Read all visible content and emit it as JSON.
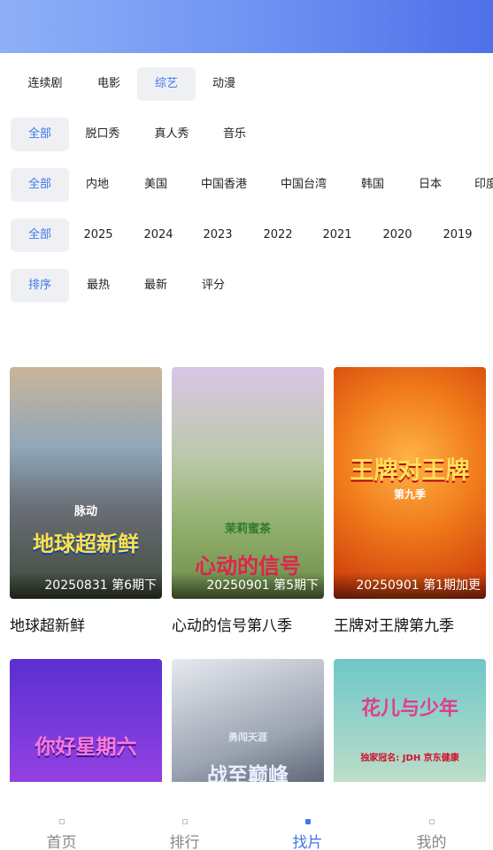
{
  "category_tabs": [
    "连续剧",
    "电影",
    "综艺",
    "动漫"
  ],
  "filters": {
    "type_row": {
      "first": "全部",
      "items": [
        "脱口秀",
        "真人秀",
        "音乐"
      ]
    },
    "region_row": {
      "first": "全部",
      "items": [
        "内地",
        "美国",
        "中国香港",
        "中国台湾",
        "韩国",
        "日本",
        "印度"
      ]
    },
    "year_row": {
      "first": "全部",
      "items": [
        "2025",
        "2024",
        "2023",
        "2022",
        "2021",
        "2020",
        "2019"
      ]
    },
    "sort_row": {
      "first": "排序",
      "items": [
        "最热",
        "最新",
        "评分"
      ]
    }
  },
  "shows": [
    {
      "title": "地球超新鲜",
      "tag": "20250831 第6期下",
      "art_text": "地球超新鲜",
      "art_sub": "脉动"
    },
    {
      "title": "心动的信号第八季",
      "tag": "20250901 第5期下",
      "art_text": "心动的信号",
      "art_sub": "茉莉蜜茶"
    },
    {
      "title": "王牌对王牌第九季",
      "tag": "20250901 第1期加更",
      "art_text": "王牌对王牌",
      "art_sub": "第九季"
    },
    {
      "title": "",
      "tag": "",
      "art_text": "你好星期六",
      "art_sub": ""
    },
    {
      "title": "",
      "tag": "",
      "art_text": "战至巅峰",
      "art_sub": "勇闯天涯"
    },
    {
      "title": "",
      "tag": "",
      "art_text": "花儿与少年",
      "art_sub": "独家冠名: JDH 京东健康"
    }
  ],
  "bottom_nav": [
    {
      "label": "首页",
      "icon": "home-icon"
    },
    {
      "label": "排行",
      "icon": "ranking-icon"
    },
    {
      "label": "找片",
      "icon": "discover-icon"
    },
    {
      "label": "我的",
      "icon": "profile-icon"
    }
  ],
  "colors": {
    "accent": "#3f78e8",
    "header_start": "#8fb0f7",
    "header_end": "#4e6fe9"
  }
}
